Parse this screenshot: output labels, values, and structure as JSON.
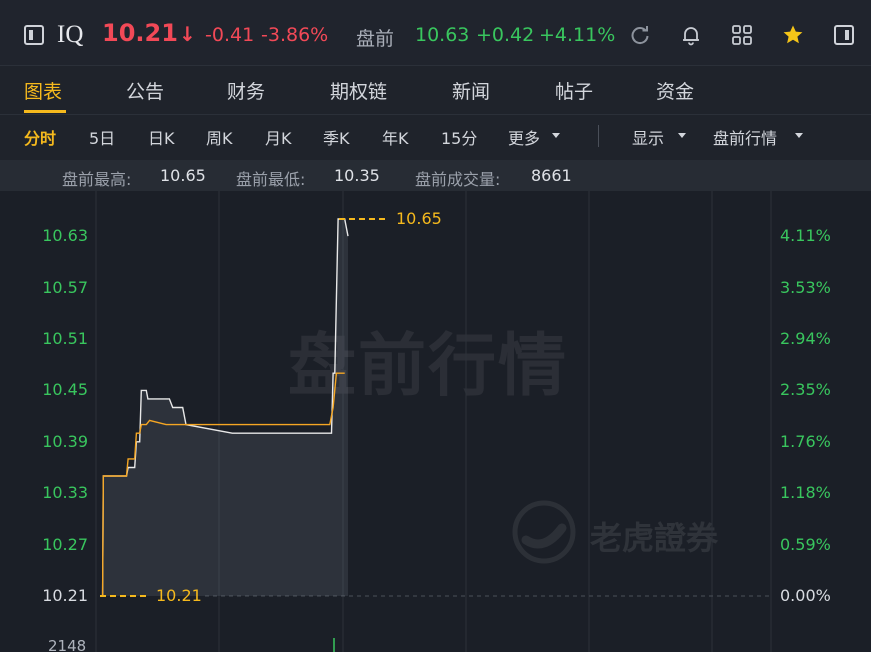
{
  "quote": {
    "ticker": "IQ",
    "price": "10.21",
    "direction_arrow": "↓",
    "change": "-0.41",
    "change_pct": "-3.86%",
    "premarket_label": "盘前",
    "premarket_price": "10.63",
    "premarket_change": "+0.42",
    "premarket_change_pct": "+4.11%",
    "colors": {
      "down": "#f24957",
      "up": "#39c65e",
      "accent": "#f5b91d"
    }
  },
  "header_icons": [
    "sidebar-left-icon",
    "refresh-icon",
    "bell-icon",
    "grid-icon",
    "star-icon",
    "sidebar-right-icon"
  ],
  "tabs": [
    "图表",
    "公告",
    "财务",
    "期权链",
    "新闻",
    "帖子",
    "资金"
  ],
  "periods": {
    "intraday": "分时",
    "five_day": "5日",
    "daily": "日K",
    "weekly": "周K",
    "monthly": "月K",
    "quarterly": "季K",
    "yearly": "年K",
    "fifteen_min": "15分",
    "more": "更多",
    "display": "显示",
    "premarket_quote": "盘前行情"
  },
  "stats": {
    "high_label": "盘前最高:",
    "high_value": "10.65",
    "low_label": "盘前最低:",
    "low_value": "10.35",
    "volume_label": "盘前成交量:",
    "volume_value": "8661"
  },
  "watermark": {
    "title": "盘前行情",
    "brand": "老虎證券"
  },
  "chart_data": {
    "type": "line",
    "ylim": [
      10.21,
      10.65
    ],
    "y_ticks_left": [
      "10.63",
      "10.57",
      "10.51",
      "10.45",
      "10.39",
      "10.33",
      "10.27",
      "10.21"
    ],
    "y_ticks_right": [
      "4.11%",
      "3.53%",
      "2.94%",
      "2.35%",
      "1.76%",
      "1.18%",
      "0.59%",
      "0.00%"
    ],
    "baseline_value": 10.21,
    "baseline_label": "10.21",
    "high_value": 10.65,
    "high_label": "10.65",
    "volume_axis_label": "2148",
    "series": [
      {
        "color": "#e8e8e8",
        "points": [
          [
            0,
            10.21
          ],
          [
            0.8,
            10.21
          ],
          [
            1,
            10.35
          ],
          [
            8,
            10.35
          ],
          [
            8.5,
            10.36
          ],
          [
            10.5,
            10.36
          ],
          [
            11,
            10.39
          ],
          [
            12,
            10.39
          ],
          [
            12.5,
            10.45
          ],
          [
            14,
            10.45
          ],
          [
            14.5,
            10.44
          ],
          [
            21,
            10.44
          ],
          [
            22,
            10.43
          ],
          [
            25,
            10.43
          ],
          [
            26,
            10.41
          ],
          [
            40,
            10.4
          ],
          [
            68,
            10.4
          ],
          [
            70,
            10.4
          ],
          [
            70.5,
            10.47
          ],
          [
            71,
            10.47
          ],
          [
            72,
            10.65
          ],
          [
            74,
            10.65
          ],
          [
            75,
            10.63
          ]
        ]
      },
      {
        "color": "#f5a623",
        "points": [
          [
            0,
            10.21
          ],
          [
            0.8,
            10.21
          ],
          [
            1,
            10.35
          ],
          [
            8,
            10.35
          ],
          [
            8.5,
            10.37
          ],
          [
            10.5,
            10.37
          ],
          [
            11,
            10.4
          ],
          [
            12,
            10.4
          ],
          [
            12.5,
            10.41
          ],
          [
            14,
            10.41
          ],
          [
            15,
            10.415
          ],
          [
            20,
            10.41
          ],
          [
            30,
            10.41
          ],
          [
            50,
            10.41
          ],
          [
            68,
            10.41
          ],
          [
            69.5,
            10.41
          ],
          [
            70.5,
            10.43
          ],
          [
            71.5,
            10.47
          ],
          [
            73,
            10.47
          ],
          [
            74,
            10.47
          ]
        ]
      }
    ]
  }
}
